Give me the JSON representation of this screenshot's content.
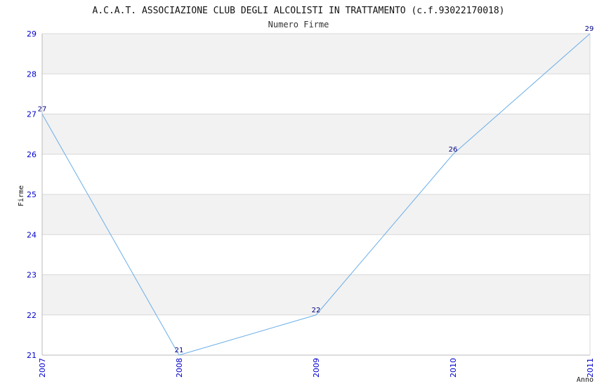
{
  "chart_data": {
    "type": "line",
    "title": "A.C.A.T. ASSOCIAZIONE CLUB DEGLI ALCOLISTI IN TRATTAMENTO (c.f.93022170018)",
    "subtitle": "Numero Firme",
    "xlabel": "Anno",
    "ylabel": "Firme",
    "categories": [
      "2007",
      "2008",
      "2009",
      "2010",
      "2011"
    ],
    "series": [
      {
        "values": [
          27,
          21,
          22,
          26,
          29
        ]
      }
    ],
    "ylim": [
      21,
      29
    ],
    "yticks": [
      21,
      22,
      23,
      24,
      25,
      26,
      27,
      28,
      29
    ],
    "grid": true,
    "colors": {
      "line": "#6aaee8",
      "tick_text": "#0000cc",
      "data_label": "#000080",
      "band": "#f2f2f2",
      "grid": "#d8d8d8",
      "axis": "#bbbbbb"
    }
  }
}
